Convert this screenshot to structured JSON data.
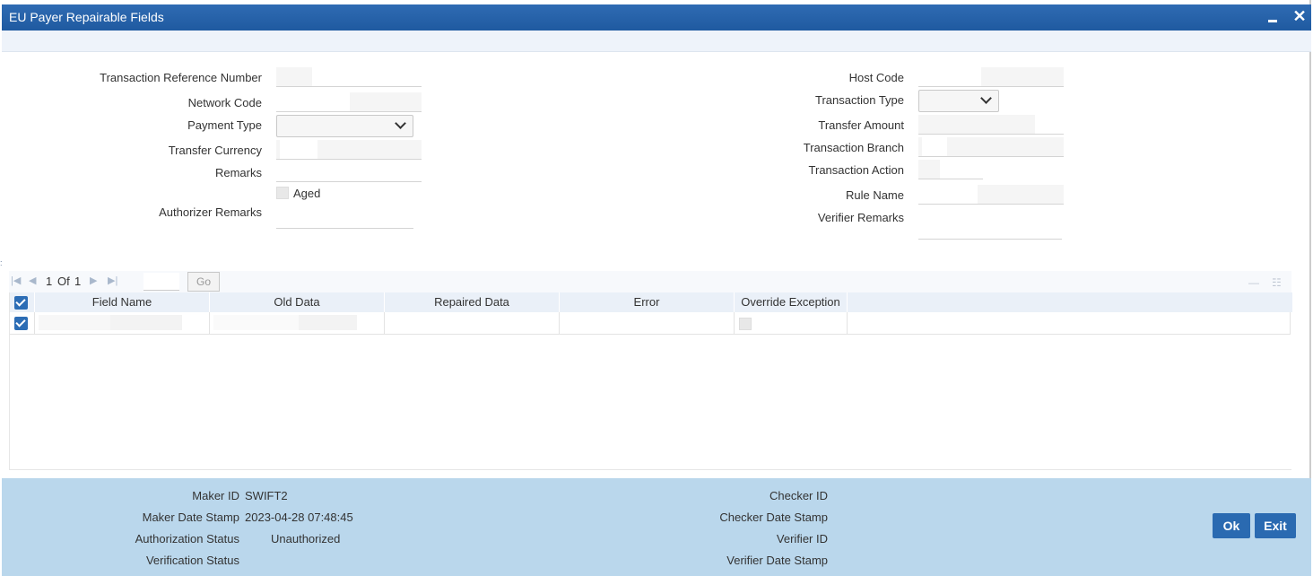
{
  "window": {
    "title": "EU Payer Repairable Fields"
  },
  "form": {
    "left": {
      "txn_ref_label": "Transaction Reference Number",
      "network_code_label": "Network Code",
      "payment_type_label": "Payment Type",
      "transfer_currency_label": "Transfer Currency",
      "remarks_label": "Remarks",
      "aged_label": "Aged",
      "authorizer_remarks_label": "Authorizer Remarks"
    },
    "right": {
      "host_code_label": "Host Code",
      "transaction_type_label": "Transaction Type",
      "transfer_amount_label": "Transfer Amount",
      "transaction_branch_label": "Transaction Branch",
      "transaction_action_label": "Transaction Action",
      "rule_name_label": "Rule Name",
      "verifier_remarks_label": "Verifier Remarks"
    }
  },
  "pager": {
    "page_current": "1",
    "of_label": "Of",
    "page_total": "1",
    "go_label": "Go"
  },
  "grid": {
    "columns": [
      "Field Name",
      "Old Data",
      "Repaired Data",
      "Error",
      "Override Exception"
    ],
    "rows": [
      {
        "checked": true,
        "field_name": "",
        "old_data": "",
        "repaired_data": "",
        "error": "",
        "override_exception": false
      }
    ]
  },
  "footer": {
    "maker_id_label": "Maker ID",
    "maker_id_value": "SWIFT2",
    "maker_date_label": "Maker Date Stamp",
    "maker_date_value": "2023-04-28 07:48:45",
    "auth_status_label": "Authorization Status",
    "auth_status_value": "Unauthorized",
    "verification_status_label": "Verification Status",
    "checker_id_label": "Checker ID",
    "checker_date_label": "Checker Date Stamp",
    "verifier_id_label": "Verifier ID",
    "verifier_date_label": "Verifier Date Stamp",
    "ok_label": "Ok",
    "exit_label": "Exit"
  },
  "colors": {
    "titlebar": "#1f5aa0",
    "footer": "#bad7ec",
    "button": "#2a6ab1",
    "checkbox": "#2c6db5"
  }
}
